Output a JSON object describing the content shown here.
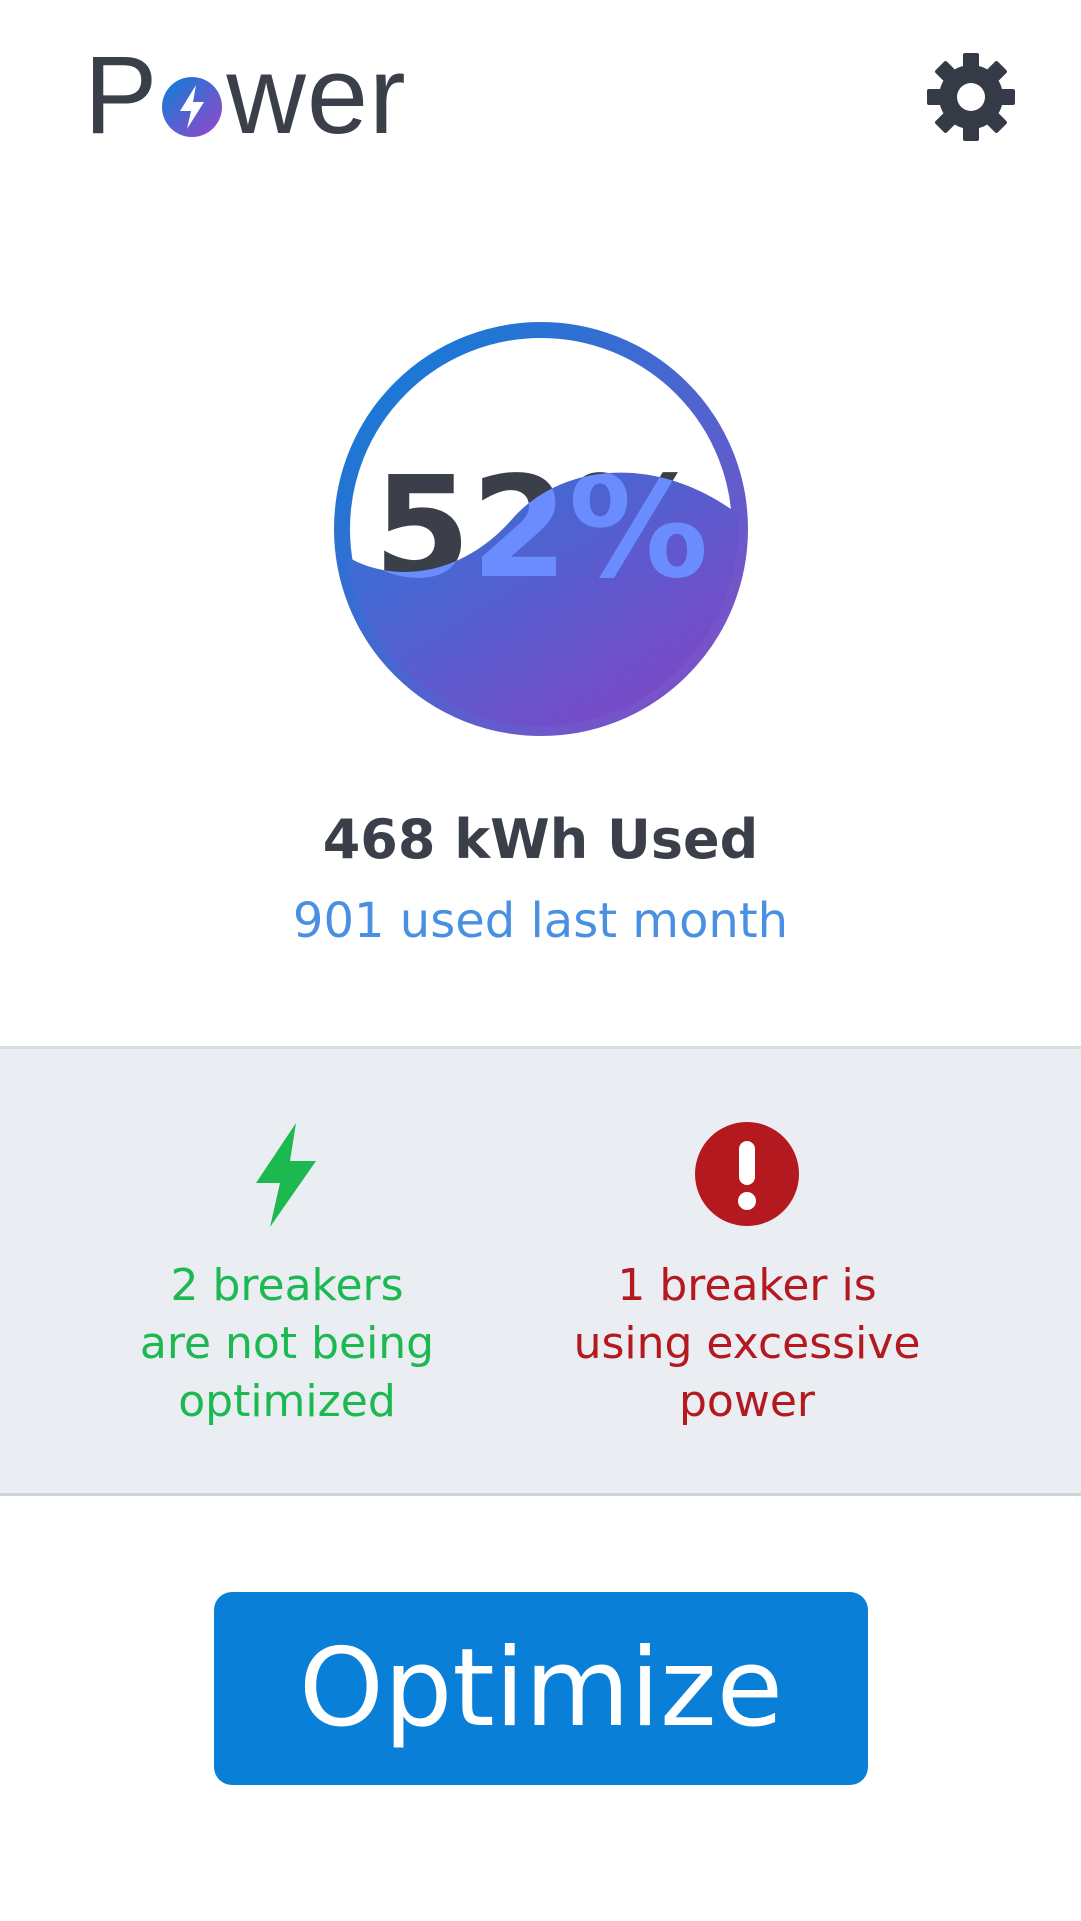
{
  "header": {
    "title_prefix": "P",
    "title_suffix": "wer",
    "logo_icon": "bolt-circle-icon",
    "settings_icon": "gear-icon"
  },
  "gauge": {
    "percent_label": "52%",
    "fill_fraction": 0.52,
    "ring_gradient": [
      "#0a7fd8",
      "#8a4cc6"
    ],
    "fill_gradient": [
      "#2a78d8",
      "#8b3fc4"
    ]
  },
  "usage": {
    "primary": "468 kWh Used",
    "secondary": "901 used last month"
  },
  "status": {
    "optimization": {
      "icon": "lightning-icon",
      "text_line1": "2 breakers",
      "text_line2": "are not being",
      "text_line3": "optimized",
      "color": "#1cb850"
    },
    "excessive": {
      "icon": "exclamation-circle-icon",
      "text_line1": "1 breaker is",
      "text_line2": "using excessive",
      "text_line3": "power",
      "color": "#b3191e"
    }
  },
  "actions": {
    "optimize_label": "Optimize"
  },
  "colors": {
    "button": "#0a7fd8",
    "panel_bg": "#eaedf2",
    "text_dark": "#3a3f4a",
    "text_blue": "#4a90e2"
  }
}
